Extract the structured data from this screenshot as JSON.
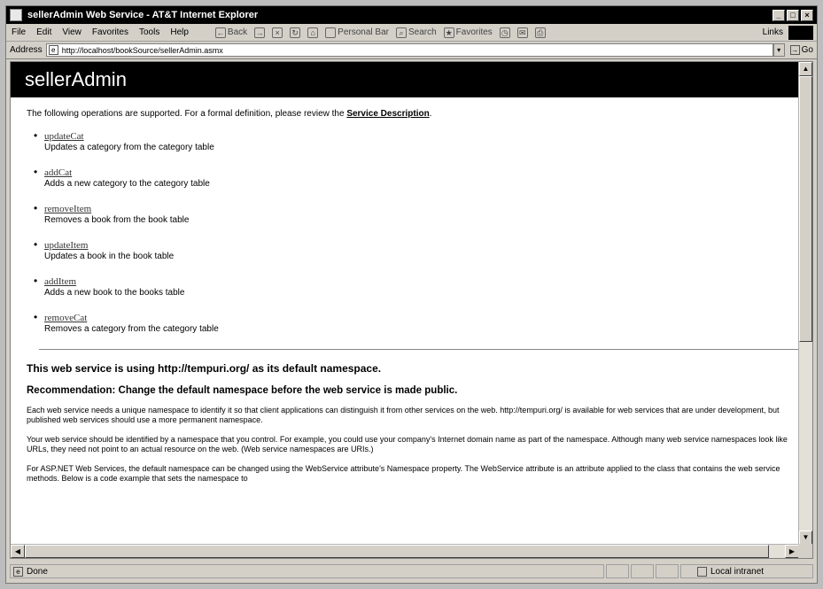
{
  "window": {
    "title": "sellerAdmin Web Service - AT&T Internet Explorer"
  },
  "menu": [
    "File",
    "Edit",
    "View",
    "Favorites",
    "Tools",
    "Help"
  ],
  "toolbar": {
    "back": "Back",
    "personal_bar": "Personal Bar",
    "search": "Search",
    "favorites": "Favorites",
    "links": "Links"
  },
  "address": {
    "label": "Address",
    "url": "http://localhost/bookSource/sellerAdmin.asmx",
    "go": "Go"
  },
  "page": {
    "heading": "sellerAdmin",
    "intro_text": "The following operations are supported. For a formal definition, please review the ",
    "intro_link": "Service Description",
    "intro_end": ".",
    "operations": [
      {
        "name": "updateCat",
        "desc": "Updates a category from the category table"
      },
      {
        "name": "addCat",
        "desc": "Adds a new category to the category table"
      },
      {
        "name": "removeItem",
        "desc": "Removes a book from the book table"
      },
      {
        "name": "updateItem",
        "desc": "Updates a book in the book table"
      },
      {
        "name": "addItem",
        "desc": "Adds a new book to the books table"
      },
      {
        "name": "removeCat",
        "desc": "Removes a category from the category table"
      }
    ],
    "ns_heading": "This web service is using http://tempuri.org/ as its default namespace.",
    "ns_recommendation": "Recommendation: Change the default namespace before the web service is made public.",
    "para1": "Each web service needs a unique namespace to identify it so that client applications can distinguish it from other services on the web. http://tempuri.org/ is available for web services that are under development, but published web services should use a more permanent namespace.",
    "para2": "Your web service should be identified by a namespace that you control. For example, you could use your company's Internet domain name as part of the namespace. Although many web service namespaces look like URLs, they need not point to an actual resource on the web. (Web service namespaces are URIs.)",
    "para3": "For ASP.NET Web Services, the default namespace can be changed using the WebService attribute's Namespace property. The WebService attribute is an attribute applied to the class that contains the web service methods. Below is a code example that sets the namespace to"
  },
  "status": {
    "text": "Done",
    "zone": "Local intranet"
  }
}
